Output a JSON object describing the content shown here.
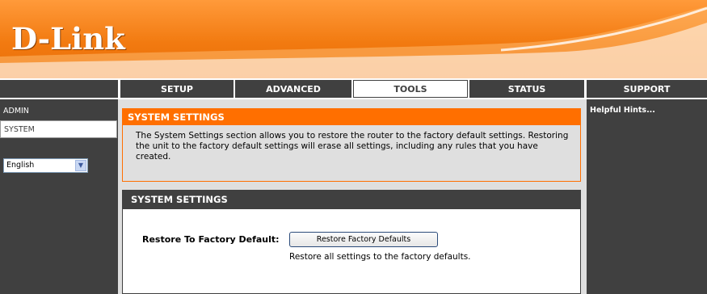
{
  "brand": {
    "logo_text": "D-Link"
  },
  "tabs": [
    {
      "label": "SETUP"
    },
    {
      "label": "ADVANCED"
    },
    {
      "label": "TOOLS",
      "active": true
    },
    {
      "label": "STATUS"
    },
    {
      "label": "SUPPORT"
    }
  ],
  "sidebar": {
    "items": [
      {
        "label": "ADMIN"
      },
      {
        "label": "SYSTEM",
        "selected": true
      }
    ],
    "language": {
      "selected": "English"
    }
  },
  "intro": {
    "title": "SYSTEM SETTINGS",
    "text": "The System Settings section allows you to restore the router to the factory default settings. Restoring the unit to the factory default settings will erase all settings, including any rules that you have created."
  },
  "settings": {
    "title": "SYSTEM SETTINGS",
    "restore_label": "Restore To Factory Default:",
    "restore_button": "Restore Factory Defaults",
    "restore_desc": "Restore all settings to the factory defaults."
  },
  "hints": {
    "title": "Helpful Hints..."
  },
  "colors": {
    "orange": "#ff6f00",
    "dark": "#404040",
    "panel": "#dfdfdf"
  },
  "icons": {
    "select_arrow": "chevron-down-icon"
  }
}
